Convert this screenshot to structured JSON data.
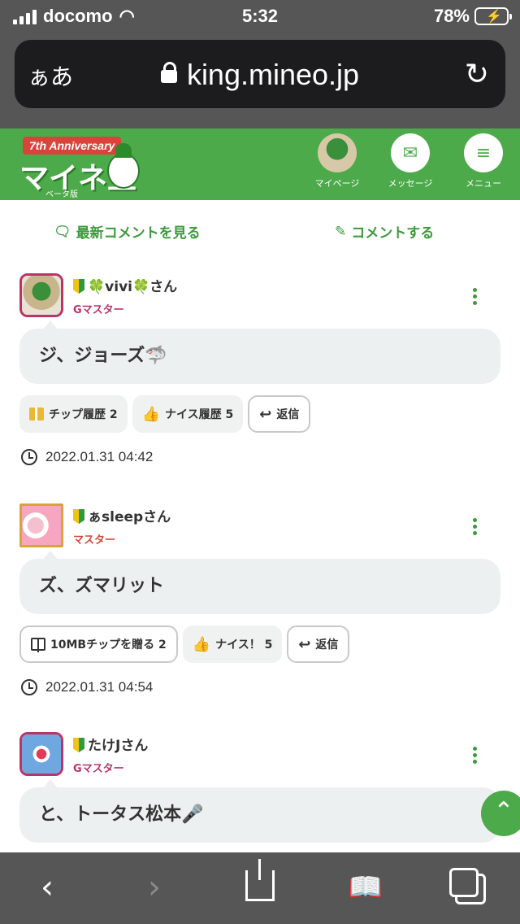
{
  "status_bar": {
    "carrier": "docomo",
    "time": "5:32",
    "battery": "78%"
  },
  "browser": {
    "aa_label": "ぁあ",
    "host": "king.mineo.jp"
  },
  "header": {
    "logo_banner": "7th Anniversary",
    "logo_title": "マイネ王",
    "logo_sub": "ベータ版",
    "nav": [
      {
        "label": "マイページ"
      },
      {
        "label": "メッセージ"
      },
      {
        "label": "メニュー"
      }
    ]
  },
  "actions": {
    "latest_comments": "最新コメントを見る",
    "post_comment": "コメントする"
  },
  "comments": [
    {
      "user": "🍀vivi🍀さん",
      "rank": "Gマスター",
      "rank_color": "#b93467",
      "text": "ジ、ジョーズ🦈",
      "chips": [
        "チップ履歴 2",
        "ナイス履歴 5",
        "返信"
      ],
      "timestamp": "2022.01.31 04:42"
    },
    {
      "user": "ぁsleepさん",
      "rank": "マスター",
      "rank_color": "#d9443a",
      "text": "ズ、ズマリット",
      "chips": [
        "10MBチップを贈る 2",
        "ナイス！ 5",
        "返信"
      ],
      "timestamp": "2022.01.31 04:54"
    },
    {
      "user": "たけJさん",
      "rank": "Gマスター",
      "rank_color": "#b93467",
      "text": "と、トータス松本🎤"
    }
  ]
}
